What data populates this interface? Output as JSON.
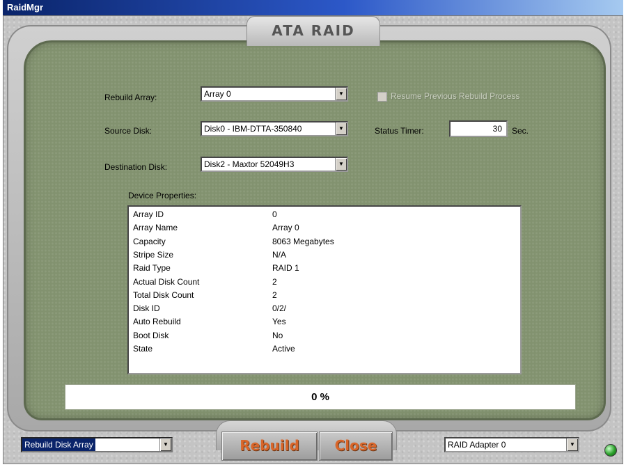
{
  "window": {
    "title": "RaidMgr"
  },
  "header": {
    "title": "ATA RAID"
  },
  "form": {
    "rebuild_array": {
      "label": "Rebuild Array:",
      "value": "Array 0"
    },
    "source_disk": {
      "label": "Source Disk:",
      "value": "Disk0 - IBM-DTTA-350840"
    },
    "destination_disk": {
      "label": "Destination Disk:",
      "value": "Disk2 - Maxtor 52049H3"
    },
    "resume_checkbox": {
      "label": "Resume Previous Rebuild Process",
      "checked": false,
      "enabled": false
    },
    "status_timer": {
      "label": "Status Timer:",
      "value": "30",
      "unit": "Sec."
    }
  },
  "device_properties": {
    "label": "Device Properties:",
    "rows": [
      {
        "name": "Array ID",
        "value": "0"
      },
      {
        "name": "Array Name",
        "value": "Array 0"
      },
      {
        "name": "Capacity",
        "value": "8063 Megabytes"
      },
      {
        "name": "Stripe Size",
        "value": "N/A"
      },
      {
        "name": "Raid Type",
        "value": "RAID 1"
      },
      {
        "name": "Actual Disk Count",
        "value": "2"
      },
      {
        "name": "Total Disk Count",
        "value": "2"
      },
      {
        "name": "Disk ID",
        "value": "0/2/"
      },
      {
        "name": "Auto Rebuild",
        "value": "Yes"
      },
      {
        "name": "Boot Disk",
        "value": "No"
      },
      {
        "name": "State",
        "value": "Active"
      }
    ]
  },
  "progress": {
    "text": "0 %",
    "fraction": 0
  },
  "footer": {
    "mode_select": "Rebuild Disk Array",
    "rebuild_button": "Rebuild",
    "close_button": "Close",
    "adapter_select": "RAID Adapter 0"
  },
  "colors": {
    "panel_green": "#82926f",
    "button_text_orange": "#d9662a",
    "status_led": "#2aa02a"
  }
}
